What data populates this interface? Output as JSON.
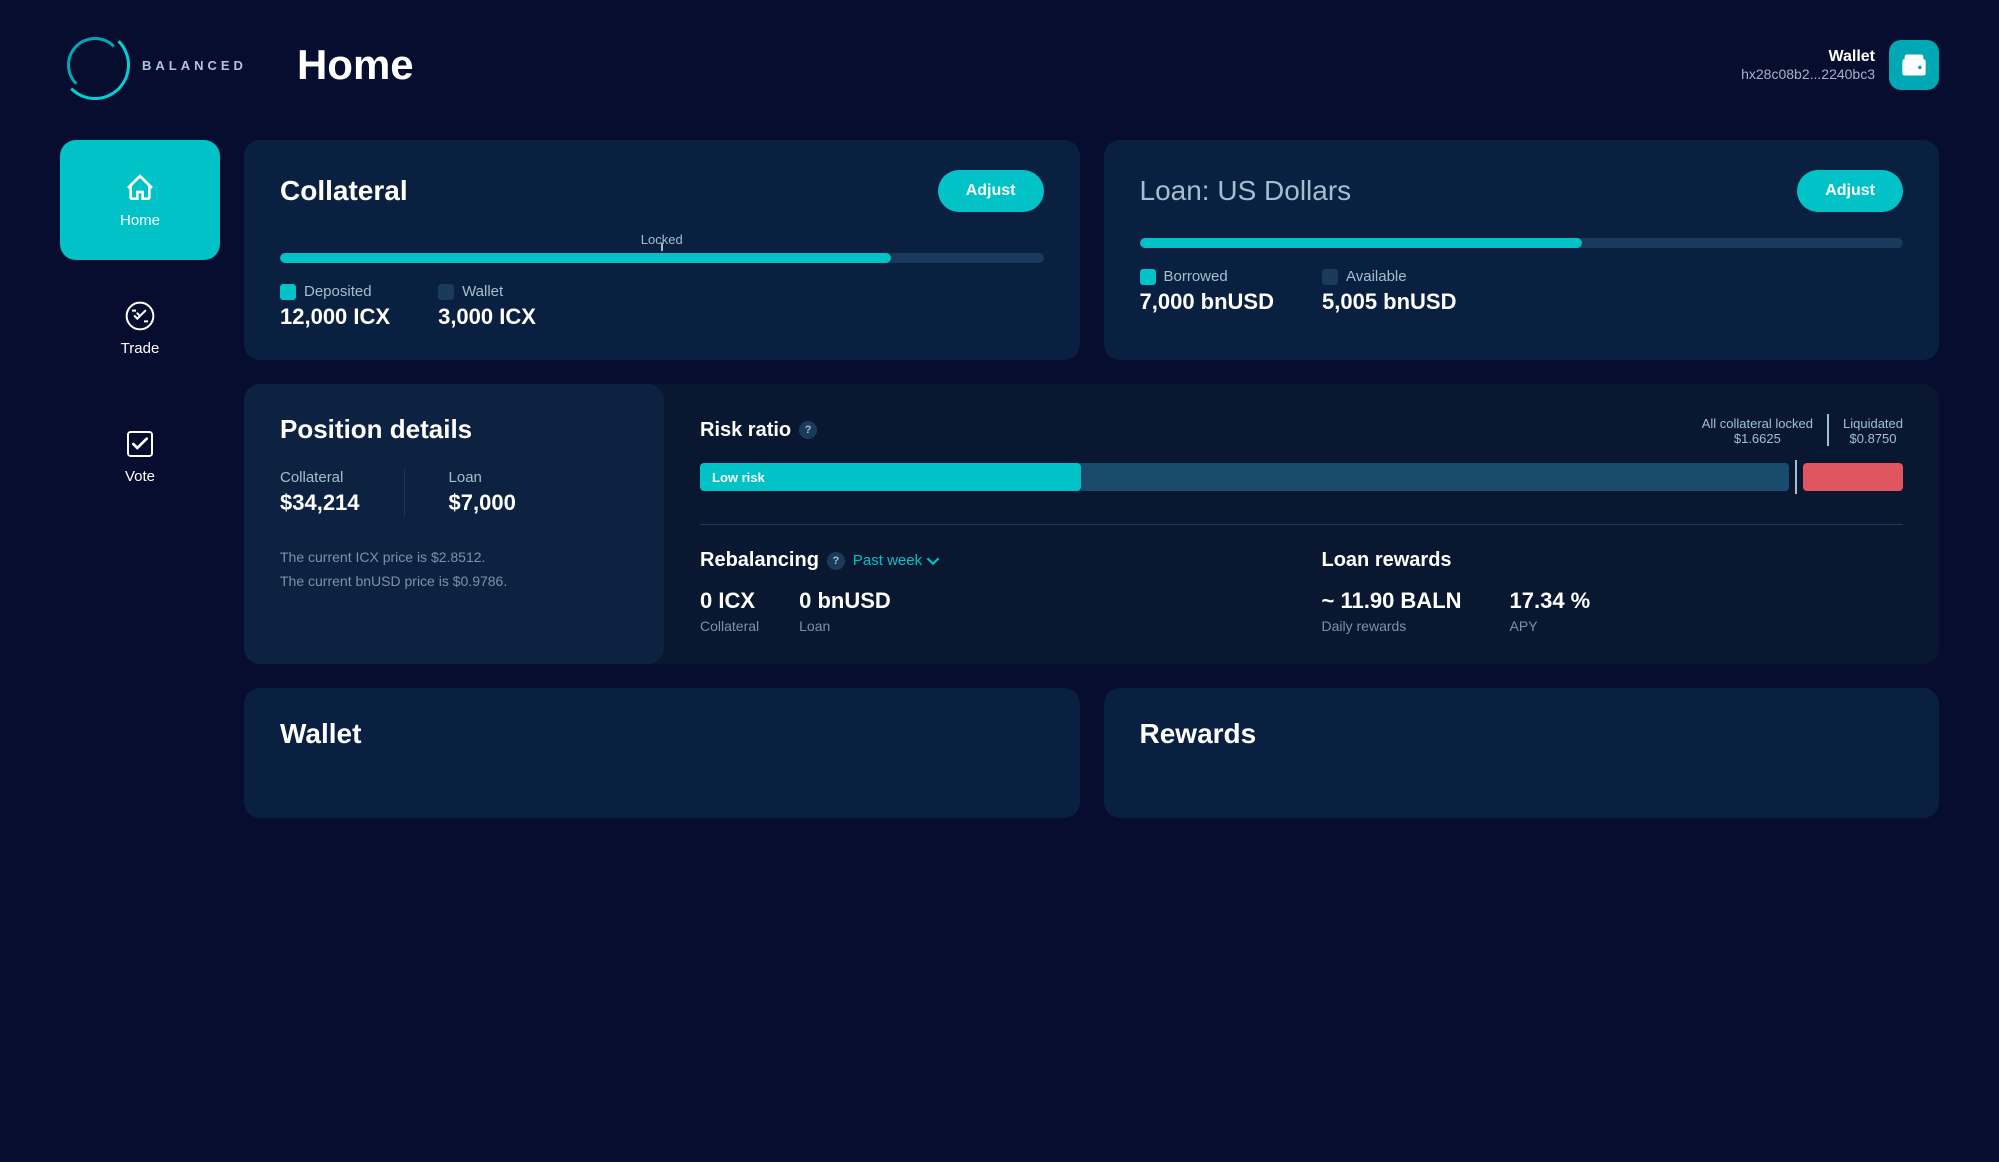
{
  "header": {
    "logo_text": "BALANCED",
    "page_title": "Home",
    "wallet_label": "Wallet",
    "wallet_address": "hx28c08b2...2240bc3"
  },
  "sidebar": {
    "items": [
      {
        "id": "home",
        "label": "Home",
        "active": true
      },
      {
        "id": "trade",
        "label": "Trade",
        "active": false
      },
      {
        "id": "vote",
        "label": "Vote",
        "active": false
      }
    ]
  },
  "collateral_card": {
    "title": "Collateral",
    "adjust_label": "Adjust",
    "progress_label": "Locked",
    "progress_percent": 80,
    "deposited_label": "Deposited",
    "deposited_value": "12,000 ICX",
    "wallet_label": "Wallet",
    "wallet_value": "3,000 ICX"
  },
  "loan_card": {
    "title": "Loan:",
    "title_sub": "US Dollars",
    "adjust_label": "Adjust",
    "progress_percent": 58,
    "borrowed_label": "Borrowed",
    "borrowed_value": "7,000 bnUSD",
    "available_label": "Available",
    "available_value": "5,005 bnUSD"
  },
  "position_details": {
    "title": "Position details",
    "collateral_label": "Collateral",
    "collateral_value": "$34,214",
    "loan_label": "Loan",
    "loan_value": "$7,000",
    "description_line1": "The current ICX price is $2.8512.",
    "description_line2": "The current bnUSD price is $0.9786."
  },
  "risk_ratio": {
    "title": "Risk ratio",
    "collateral_locked_label": "All collateral locked",
    "collateral_locked_value": "$1.6625",
    "liquidated_label": "Liquidated",
    "liquidated_value": "$0.8750",
    "low_risk_label": "Low risk",
    "bar_low_percent": 35
  },
  "rebalancing": {
    "title": "Rebalancing",
    "period_label": "Past week",
    "collateral_value": "0 ICX",
    "collateral_label": "Collateral",
    "loan_value": "0 bnUSD",
    "loan_label": "Loan"
  },
  "loan_rewards": {
    "title": "Loan rewards",
    "daily_value": "~ 11.90 BALN",
    "daily_label": "Daily rewards",
    "apy_value": "17.34 %",
    "apy_label": "APY"
  },
  "bottom_cards": {
    "wallet_title": "Wallet",
    "rewards_title": "Rewards"
  }
}
